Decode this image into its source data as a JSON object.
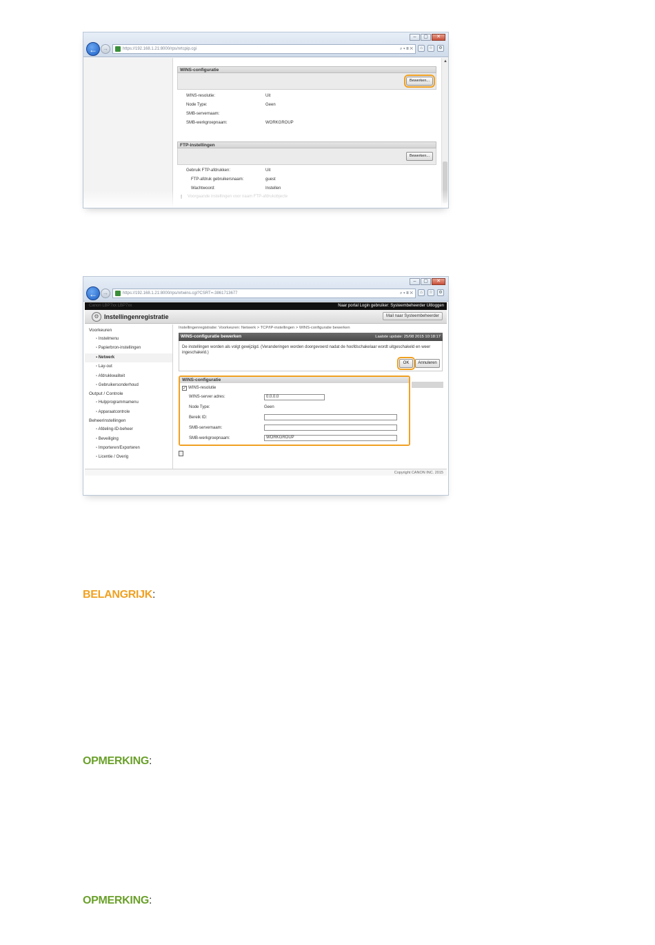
{
  "shot1": {
    "url": "https://192.168.1.21:8000/rps/nrtcpip.cgi",
    "addr_controls": "⌕ ▾ ≣ ✕",
    "section1_title": "WINS-configuratie",
    "section1_button": "Bewerken...",
    "wins_rows": [
      {
        "label": "WINS-resolutie:",
        "value": "Uit"
      },
      {
        "label": "Node Type:",
        "value": "Geen"
      },
      {
        "label": "SMB-servernaam:",
        "value": ""
      },
      {
        "label": "SMB-werkgroepnaam:",
        "value": "WORKGROUP"
      }
    ],
    "section2_title": "FTP-instellingen",
    "section2_button": "Bewerken...",
    "ftp_rows": [
      {
        "label": "Gebruik FTP-afdrukken:",
        "value": "Uit",
        "indent": false
      },
      {
        "label": "FTP-afdruk gebruikersnaam:",
        "value": "guest",
        "indent": true
      },
      {
        "label": "Wachtwoord:",
        "value": "Instellen",
        "indent": true
      }
    ],
    "cutoff_text": "Voorgaande instellingen voor naam FTP-afdrukobjecte"
  },
  "shot2": {
    "url": "https://192.168.1.21:8000/rps/nrtwins.cgi?CSRT=-3861713677",
    "addr_controls": "⌕ ▾ ≣ ✕",
    "topbar_left": "Canon LBP7xx LBP7xx",
    "topbar_right": "Naar portal   Login gebruiker: Systeembeheerder   Uitloggen",
    "app_title": "Instellingenregistratie",
    "portal_button": "Mail naar Systeembeheerder",
    "sidebar": [
      {
        "label": "Voorkeuren",
        "type": "group"
      },
      {
        "label": "▫ Instelmenu",
        "type": "item"
      },
      {
        "label": "▫ Papierbron-instellingen",
        "type": "item"
      },
      {
        "label": "▪ Netwerk",
        "type": "active"
      },
      {
        "label": "▫ Lay-out",
        "type": "item"
      },
      {
        "label": "▫ Afdrukkwaliteit",
        "type": "item"
      },
      {
        "label": "▫ Gebruikersonderhoud",
        "type": "item"
      },
      {
        "label": "Output / Controle",
        "type": "group"
      },
      {
        "label": "▫ Hulpprogrammamenu",
        "type": "item"
      },
      {
        "label": "▫ Apparaatcontrole",
        "type": "item"
      },
      {
        "label": "Beheerinstellingen",
        "type": "group"
      },
      {
        "label": "▫ Afdeling-ID-beheer",
        "type": "item"
      },
      {
        "label": "▫ Beveiliging",
        "type": "item"
      },
      {
        "label": "▫ Importeren/Exporteren",
        "type": "item"
      },
      {
        "label": "▫ Licentie / Overig",
        "type": "item"
      }
    ],
    "breadcrumb": "Instellingenregistratie: Voorkeuren: Netwerk > TCP/IP-instellingen > WINS-configuratie bewerken",
    "panel_title": "WINS-configuratie bewerken",
    "last_update": "Laatste update: 25/08 2015 10:18:17",
    "info_text": "De instellingen worden als volgt gewijzigd. (Veranderingen worden doorgevoerd nadat de hoofdschakelaar wordt uitgeschakeld en weer ingeschakeld.)",
    "ok_label": "OK",
    "cancel_label": "Annuleren",
    "form_title": "WINS-configuratie",
    "checkbox_label": "WINS-resolutie",
    "checkbox_mark": "✓",
    "fields": [
      {
        "label": "WINS-server adres:",
        "value": "0.0.0.0",
        "kind": "short"
      },
      {
        "label": "Node Type:",
        "value": "Geen",
        "kind": "text"
      },
      {
        "label": "Bereik ID:",
        "value": "",
        "kind": "long"
      },
      {
        "label": "SMB-servernaam:",
        "value": "",
        "kind": "long"
      },
      {
        "label": "SMB-werkgroepnaam:",
        "value": "WORKGROUP",
        "kind": "long"
      }
    ],
    "footer": "Copyright CANON INC. 2015"
  },
  "notes": [
    {
      "label": "BELANGRIJK",
      "color": "#f0a020"
    },
    {
      "label": "OPMERKING",
      "color": "#6aa02a"
    },
    {
      "label": "OPMERKING",
      "color": "#6aa02a"
    }
  ],
  "note_colon": ":"
}
